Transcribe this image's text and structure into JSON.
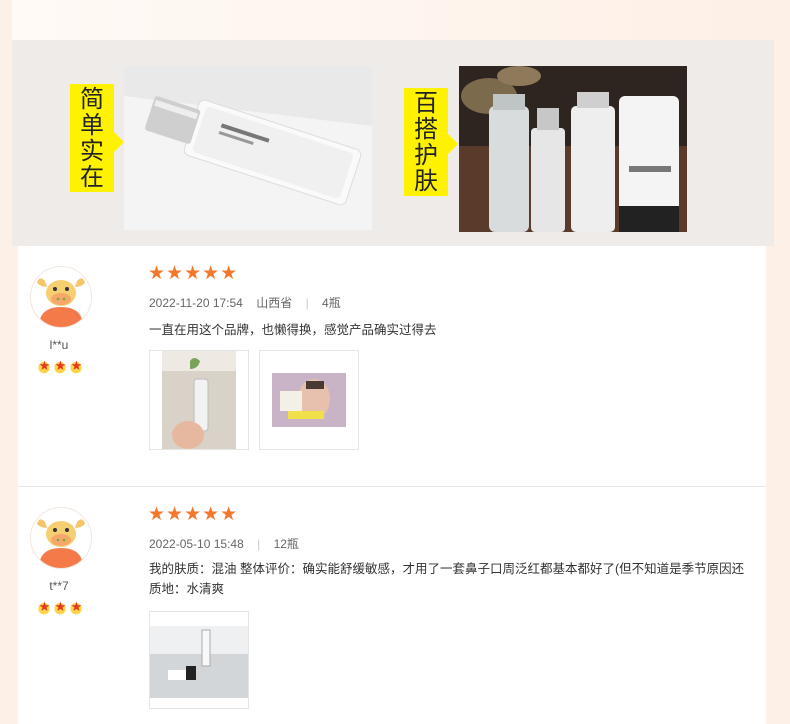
{
  "banner": {
    "tag1": [
      "简",
      "单",
      "实",
      "在"
    ],
    "tag2": [
      "百",
      "搭",
      "护",
      "肤"
    ]
  },
  "reviews": [
    {
      "username": "l**u",
      "stars": "★★★★★",
      "level": "★★★",
      "date": "2022-11-20 17:54",
      "location": "山西省",
      "spec": "4瓶",
      "comment_lines": [
        "一直在用这个品牌，也懒得换，感觉产品确实过得去"
      ]
    },
    {
      "username": "t**7",
      "stars": "★★★★★",
      "level": "★★★",
      "date": "2022-05-10 15:48",
      "location": "",
      "spec": "12瓶",
      "comment_lines": [
        "我的肤质：混油 整体评价：确实能舒缓敏感，才用了一套鼻子口周泛红都基本都好了(但不知道是季节原因还",
        "质地：水清爽"
      ]
    }
  ],
  "colors": {
    "star": "#f4782b",
    "tag_bg": "#fff200",
    "avatar_accent": "#f47a4a"
  },
  "icons": [
    "bull-avatar-icon",
    "star-icon",
    "level-badge-icon"
  ]
}
